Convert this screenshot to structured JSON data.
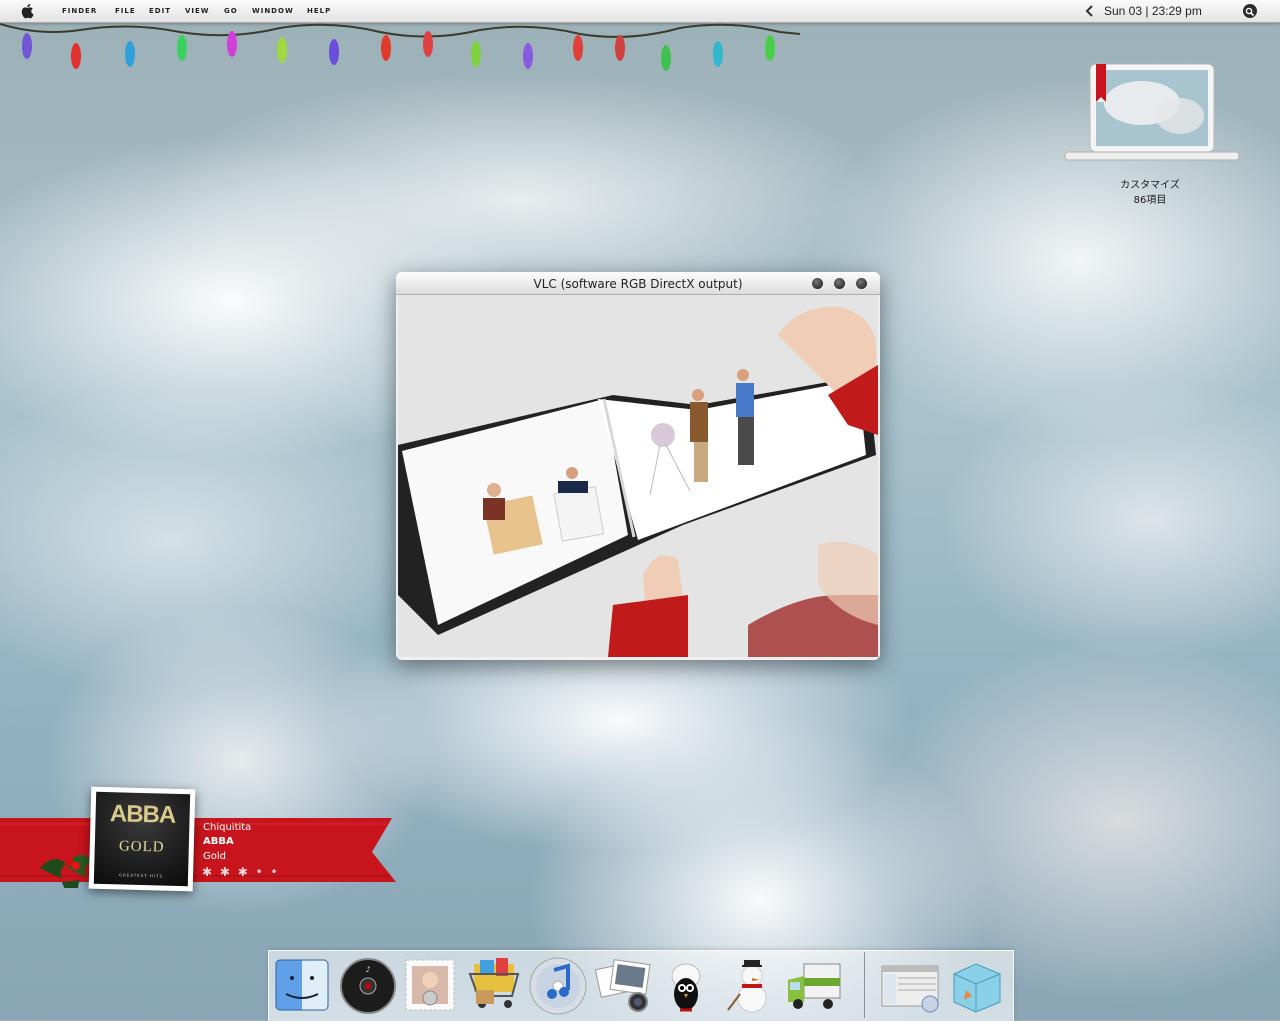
{
  "menubar": {
    "menus": [
      "FINDER",
      "FILE",
      "EDIT",
      "VIEW",
      "GO",
      "WINDOW",
      "HELP"
    ],
    "clock": "Sun 03 | 23:29 pm"
  },
  "desktop": {
    "drive_label_line1": "カスタマイズ",
    "drive_label_line2": "86項目"
  },
  "vlc": {
    "title": "VLC (software RGB DirectX output)"
  },
  "now_playing": {
    "song": "Chiquitita",
    "artist": "ABBA",
    "album": "Gold",
    "album_art_title": "ABBA",
    "album_art_subtitle": "GOLD",
    "album_art_caption": "GREATEST HITS",
    "rating_stars": "✱ ✱ ✱ • •"
  },
  "dock": {
    "items": [
      "finder-icon",
      "itunes-remote-icon",
      "mail-stamp-icon",
      "shopping-cart-icon",
      "itunes-icon",
      "iphoto-icon",
      "penguin-app-icon",
      "snowman-icon",
      "delivery-truck-icon",
      "itunes-window-icon",
      "box-icon"
    ]
  },
  "colors": {
    "ribbon_red": "#c8141c",
    "menubar": "#ececec"
  }
}
